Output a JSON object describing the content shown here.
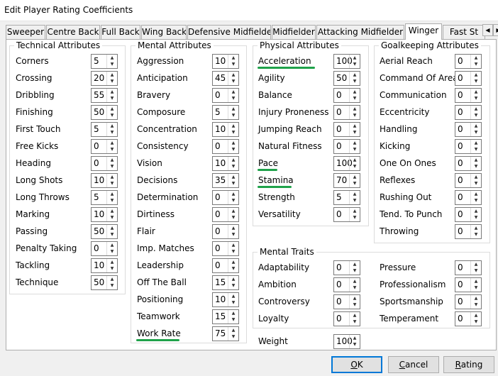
{
  "window": {
    "title": "Edit Player Rating Coefficients"
  },
  "tabs": [
    {
      "label": "Sweeper",
      "active": false
    },
    {
      "label": "Centre Back",
      "active": false
    },
    {
      "label": "Full Back",
      "active": false
    },
    {
      "label": "Wing Back",
      "active": false
    },
    {
      "label": "Defensive Midfielder",
      "active": false
    },
    {
      "label": "Midfielder",
      "active": false
    },
    {
      "label": "Attacking Midfielder",
      "active": false
    },
    {
      "label": "Winger",
      "active": true
    },
    {
      "label": "Fast St",
      "active": false
    }
  ],
  "technical": {
    "title": "Technical Attributes",
    "rows": [
      {
        "label": "Corners",
        "value": "5"
      },
      {
        "label": "Crossing",
        "value": "20"
      },
      {
        "label": "Dribbling",
        "value": "55"
      },
      {
        "label": "Finishing",
        "value": "50"
      },
      {
        "label": "First Touch",
        "value": "5"
      },
      {
        "label": "Free Kicks",
        "value": "0"
      },
      {
        "label": "Heading",
        "value": "0"
      },
      {
        "label": "Long Shots",
        "value": "10"
      },
      {
        "label": "Long Throws",
        "value": "5"
      },
      {
        "label": "Marking",
        "value": "10"
      },
      {
        "label": "Passing",
        "value": "50"
      },
      {
        "label": "Penalty Taking",
        "value": "0"
      },
      {
        "label": "Tackling",
        "value": "10"
      },
      {
        "label": "Technique",
        "value": "50"
      }
    ]
  },
  "mental": {
    "title": "Mental Attributes",
    "rows": [
      {
        "label": "Aggression",
        "value": "10"
      },
      {
        "label": "Anticipation",
        "value": "45"
      },
      {
        "label": "Bravery",
        "value": "0"
      },
      {
        "label": "Composure",
        "value": "5"
      },
      {
        "label": "Concentration",
        "value": "10"
      },
      {
        "label": "Consistency",
        "value": "0"
      },
      {
        "label": "Vision",
        "value": "10"
      },
      {
        "label": "Decisions",
        "value": "35"
      },
      {
        "label": "Determination",
        "value": "0"
      },
      {
        "label": "Dirtiness",
        "value": "0"
      },
      {
        "label": "Flair",
        "value": "0"
      },
      {
        "label": "Imp. Matches",
        "value": "0"
      },
      {
        "label": "Leadership",
        "value": "0"
      },
      {
        "label": "Off The Ball",
        "value": "15"
      },
      {
        "label": "Positioning",
        "value": "10"
      },
      {
        "label": "Teamwork",
        "value": "15"
      },
      {
        "label": "Work Rate",
        "value": "75"
      }
    ]
  },
  "physical": {
    "title": "Physical Attributes",
    "rows": [
      {
        "label": "Acceleration",
        "value": "100"
      },
      {
        "label": "Agility",
        "value": "50"
      },
      {
        "label": "Balance",
        "value": "0"
      },
      {
        "label": "Injury Proneness",
        "value": "0"
      },
      {
        "label": "Jumping Reach",
        "value": "0"
      },
      {
        "label": "Natural Fitness",
        "value": "0"
      },
      {
        "label": "Pace",
        "value": "100"
      },
      {
        "label": "Stamina",
        "value": "70"
      },
      {
        "label": "Strength",
        "value": "5"
      },
      {
        "label": "Versatility",
        "value": "0"
      }
    ]
  },
  "goalkeeping": {
    "title": "Goalkeeping Attributes",
    "rows": [
      {
        "label": "Aerial Reach",
        "value": "0"
      },
      {
        "label": "Command Of Area",
        "value": "0"
      },
      {
        "label": "Communication",
        "value": "0"
      },
      {
        "label": "Eccentricity",
        "value": "0"
      },
      {
        "label": "Handling",
        "value": "0"
      },
      {
        "label": "Kicking",
        "value": "0"
      },
      {
        "label": "One On Ones",
        "value": "0"
      },
      {
        "label": "Reflexes",
        "value": "0"
      },
      {
        "label": "Rushing Out",
        "value": "0"
      },
      {
        "label": "Tend. To Punch",
        "value": "0"
      },
      {
        "label": "Throwing",
        "value": "0"
      }
    ]
  },
  "traits": {
    "title": "Mental Traits",
    "left": [
      {
        "label": "Adaptability",
        "value": "0"
      },
      {
        "label": "Ambition",
        "value": "0"
      },
      {
        "label": "Controversy",
        "value": "0"
      },
      {
        "label": "Loyalty",
        "value": "0"
      }
    ],
    "right": [
      {
        "label": "Pressure",
        "value": "0"
      },
      {
        "label": "Professionalism",
        "value": "0"
      },
      {
        "label": "Sportsmanship",
        "value": "0"
      },
      {
        "label": "Temperament",
        "value": "0"
      }
    ]
  },
  "weight": {
    "label": "Weight",
    "value": "100"
  },
  "buttons": {
    "ok": {
      "label": "OK",
      "accel": "O",
      "rest": "K"
    },
    "cancel": {
      "label": "Cancel",
      "accel": "C",
      "rest": "ancel"
    },
    "rating": {
      "label": "Rating",
      "accel": "R",
      "rest": "ating"
    }
  },
  "highlight_color": "#1fa24a",
  "highlighted": [
    "Work Rate",
    "Acceleration",
    "Pace",
    "Stamina"
  ]
}
